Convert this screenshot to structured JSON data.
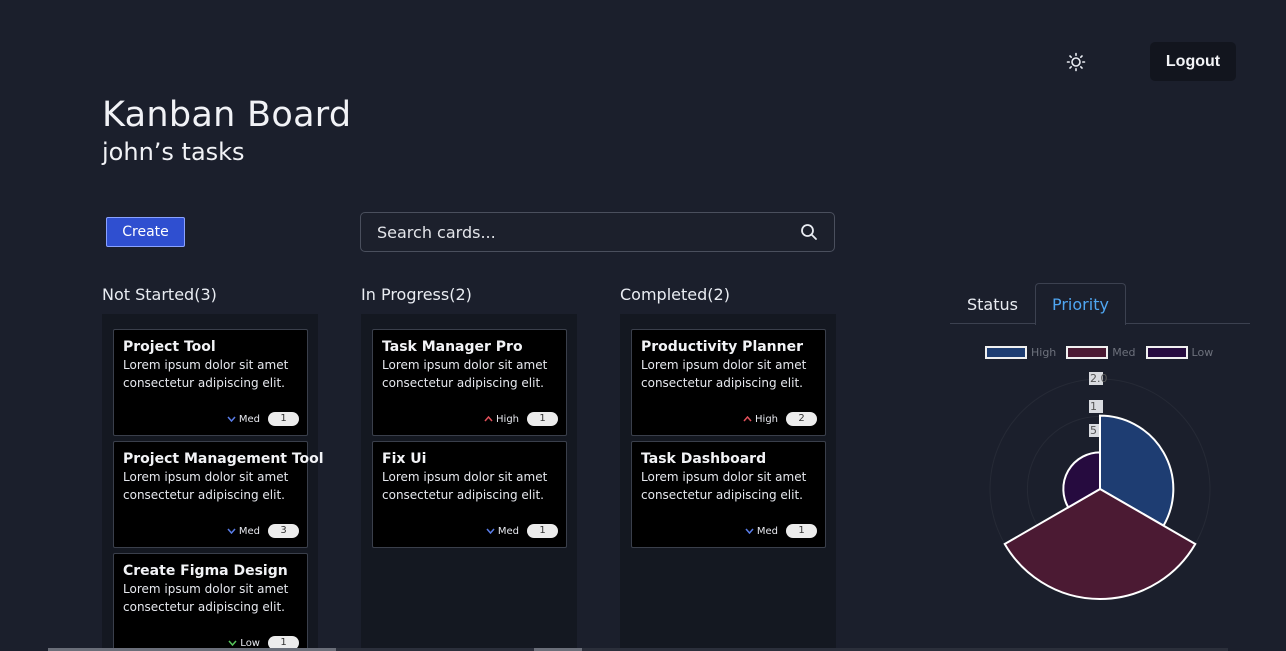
{
  "header": {
    "title": "Kanban Board",
    "subtitle": "john’s tasks",
    "logout_label": "Logout",
    "theme_icon": "sun-icon"
  },
  "toolbar": {
    "create_label": "Create",
    "search_placeholder": "Search cards..."
  },
  "columns": [
    {
      "title": "Not Started(3)",
      "cards": [
        {
          "title": "Project Tool",
          "desc1": "Lorem ipsum dolor sit amet",
          "desc2": "consectetur adipiscing elit.",
          "priority": "Med",
          "count": "1"
        },
        {
          "title": "Project Management Tool",
          "desc1": "Lorem ipsum dolor sit amet",
          "desc2": "consectetur adipiscing elit.",
          "priority": "Med",
          "count": "3"
        },
        {
          "title": "Create Figma Design",
          "desc1": "Lorem ipsum dolor sit amet",
          "desc2": "consectetur adipiscing elit.",
          "priority": "Low",
          "count": "1"
        }
      ]
    },
    {
      "title": "In Progress(2)",
      "cards": [
        {
          "title": "Task Manager Pro",
          "desc1": "Lorem ipsum dolor sit amet",
          "desc2": "consectetur adipiscing elit.",
          "priority": "High",
          "count": "1"
        },
        {
          "title": "Fix Ui",
          "desc1": "Lorem ipsum dolor sit amet",
          "desc2": "consectetur adipiscing elit.",
          "priority": "Med",
          "count": "1"
        }
      ]
    },
    {
      "title": "Completed(2)",
      "cards": [
        {
          "title": "Productivity Planner",
          "desc1": "Lorem ipsum dolor sit amet",
          "desc2": "consectetur adipiscing elit.",
          "priority": "High",
          "count": "2"
        },
        {
          "title": "Task Dashboard",
          "desc1": "Lorem ipsum dolor sit amet",
          "desc2": "consectetur adipiscing elit.",
          "priority": "Med",
          "count": "1"
        }
      ]
    }
  ],
  "tabs": [
    {
      "label": "Status",
      "active": false
    },
    {
      "label": "Priority",
      "active": true
    }
  ],
  "chart_data": {
    "type": "polarArea",
    "legend_position": "top",
    "categories": [
      "High",
      "Med",
      "Low"
    ],
    "values": [
      2,
      3,
      1
    ],
    "colors": [
      "#1e3d72",
      "#4b1a33",
      "#260b3f"
    ],
    "tick_labels": [
      "2.0",
      "1",
      "5"
    ]
  },
  "colors": {
    "background": "#1b1f2c",
    "column": "#141821",
    "card": "#000000",
    "primary": "#2f4fd0",
    "high": "#e0505a",
    "med": "#5a7de8",
    "low": "#57c45b",
    "tab_active": "#4fa6f2"
  }
}
